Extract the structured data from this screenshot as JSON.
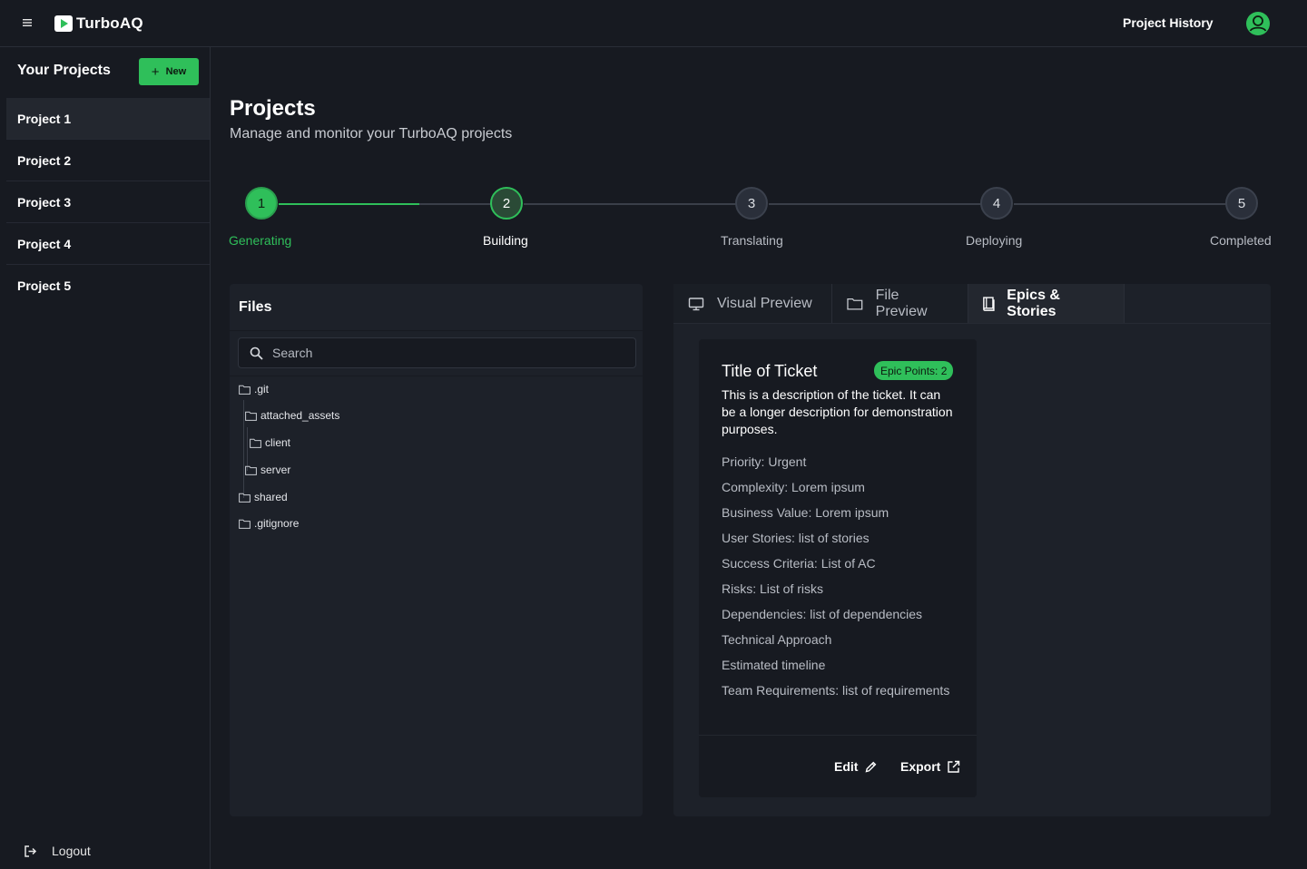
{
  "header": {
    "app_name": "TurboAQ",
    "history_label": "Project History"
  },
  "sidebar": {
    "title": "Your Projects",
    "new_label": "New",
    "projects": [
      {
        "label": "Project 1",
        "active": true
      },
      {
        "label": "Project 2"
      },
      {
        "label": "Project 3"
      },
      {
        "label": "Project 4"
      },
      {
        "label": "Project 5"
      }
    ],
    "logout_label": "Logout"
  },
  "main": {
    "title": "Projects",
    "subtitle": "Manage and monitor your TurboAQ projects"
  },
  "stepper": {
    "steps": [
      {
        "number": "1",
        "label": "Generating",
        "state": "done"
      },
      {
        "number": "2",
        "label": "Building",
        "state": "current"
      },
      {
        "number": "3",
        "label": "Translating",
        "state": "pending"
      },
      {
        "number": "4",
        "label": "Deploying",
        "state": "pending"
      },
      {
        "number": "5",
        "label": "Completed",
        "state": "pending"
      }
    ]
  },
  "files": {
    "title": "Files",
    "search_placeholder": "Search",
    "tree": [
      {
        "name": ".git",
        "type": "folder-icon"
      },
      {
        "name": "attached_assets",
        "type": "folder-icon"
      },
      {
        "name": "client",
        "type": "folder-icon"
      },
      {
        "name": "server",
        "type": "folder-icon"
      },
      {
        "name": "shared",
        "type": "folder-icon"
      },
      {
        "name": ".gitignore",
        "type": "folder-icon"
      }
    ]
  },
  "preview": {
    "tabs": [
      {
        "label": "Visual Preview",
        "icon": "monitor-icon"
      },
      {
        "label": "File Preview",
        "icon": "folder-icon"
      },
      {
        "label": "Epics & Stories",
        "icon": "book-icon",
        "active": true
      }
    ],
    "ticket": {
      "title": "Title of Ticket",
      "badge": "Epic Points: 2",
      "description": "This is a description of the ticket. It can be a longer description for demonstration purposes.",
      "fields": [
        "Priority: Urgent",
        "Complexity: Lorem ipsum",
        "Business Value: Lorem ipsum",
        "User Stories: list of stories",
        "Success Criteria: List of AC",
        "Risks: List of risks",
        "Dependencies: list of dependencies",
        "Technical Approach",
        "Estimated timeline",
        "Team Requirements: list of requirements"
      ],
      "edit_label": "Edit",
      "export_label": "Export"
    }
  },
  "colors": {
    "accent": "#2fbf5a",
    "background": "#171a21",
    "panel": "#1d2129"
  }
}
